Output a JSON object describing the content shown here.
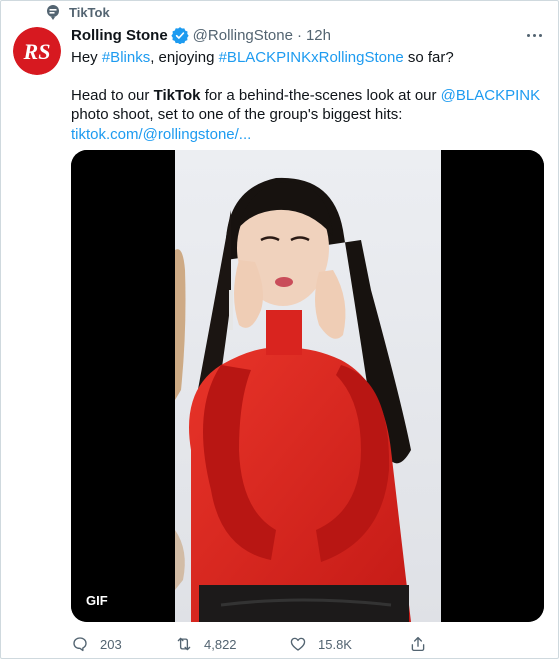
{
  "context": {
    "label": "TikTok"
  },
  "author": {
    "name": "Rolling Stone",
    "handle": "@RollingStone",
    "separator": "·",
    "time": "12h",
    "avatar_text": "RS"
  },
  "tweet": {
    "line1": [
      {
        "text": "Hey ",
        "style": "plain"
      },
      {
        "text": "#Blinks",
        "style": "link"
      },
      {
        "text": ", enjoying ",
        "style": "plain"
      },
      {
        "text": "#BLACKPINKxRollingStone",
        "style": "link"
      },
      {
        "text": " so far?",
        "style": "plain"
      }
    ],
    "line2": [
      {
        "text": "Head to our ",
        "style": "plain"
      },
      {
        "text": "TikTok",
        "style": "bold"
      },
      {
        "text": " for a behind-the-scenes look at our ",
        "style": "plain"
      },
      {
        "text": "@BLACKPINK",
        "style": "link"
      },
      {
        "text": " photo shoot, set to one of the group's biggest hits: ",
        "style": "plain"
      },
      {
        "text": "tiktok.com/@rollingstone/...",
        "style": "link"
      }
    ]
  },
  "media": {
    "badge": "GIF"
  },
  "actions": {
    "replies": "203",
    "retweets": "4,822",
    "likes": "15.8K"
  },
  "colors": {
    "link": "#1d9bf0",
    "verified": "#1d9bf0",
    "avatar_bg": "#d71920",
    "muted": "#536471",
    "sweater": "#d8231f"
  }
}
